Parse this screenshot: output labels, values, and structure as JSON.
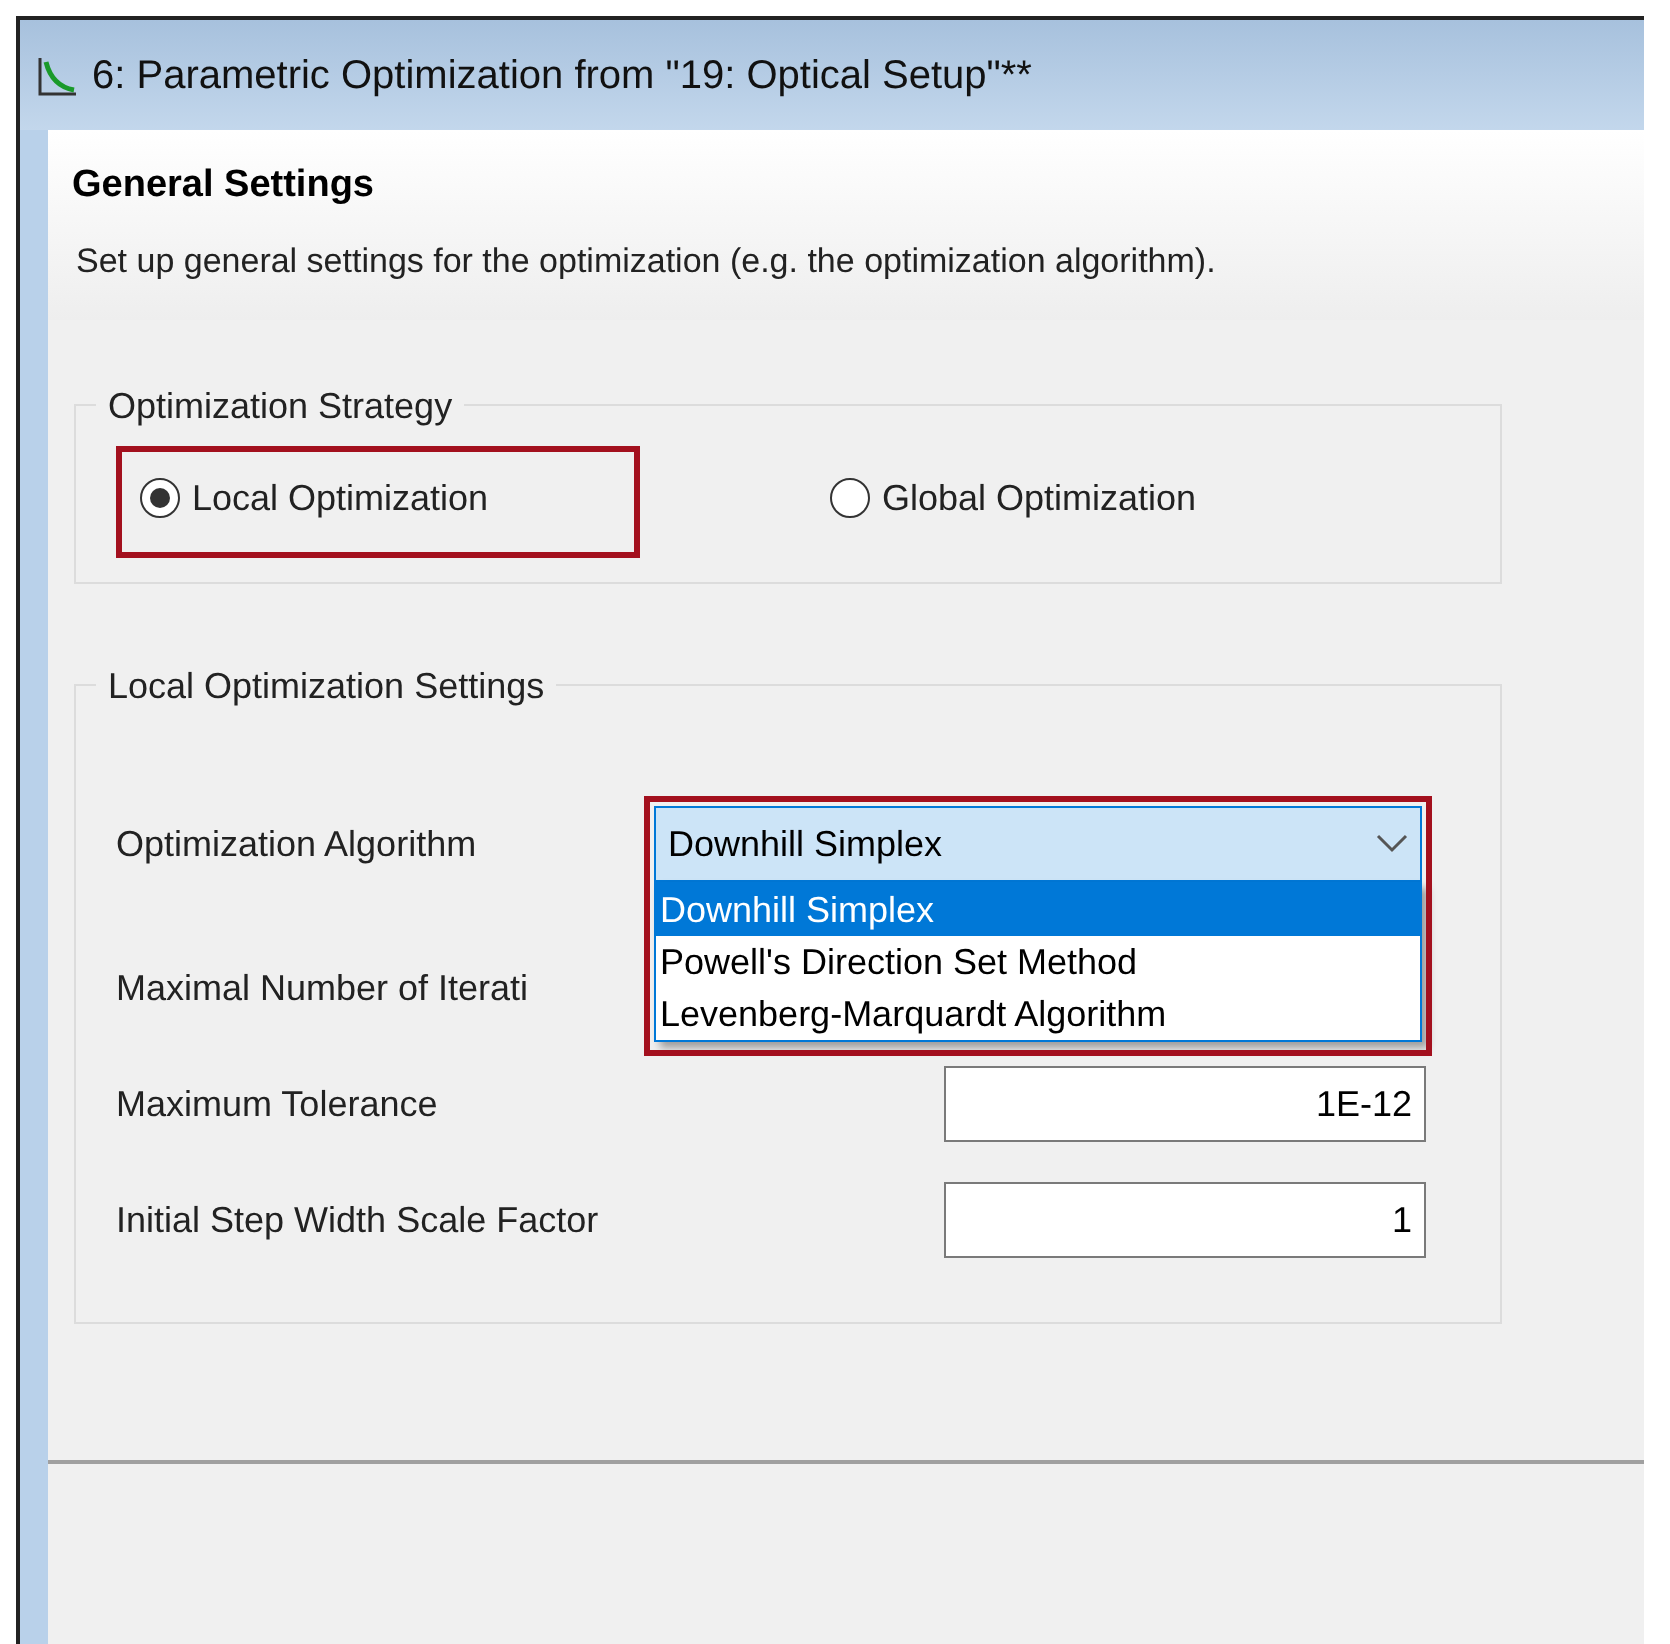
{
  "window": {
    "title": "6: Parametric Optimization from \"19: Optical Setup\"**"
  },
  "header": {
    "title": "General Settings",
    "description": "Set up general settings for the optimization (e.g. the optimization algorithm)."
  },
  "strategy": {
    "legend": "Optimization Strategy",
    "options": [
      {
        "label": "Local Optimization",
        "selected": true,
        "highlighted": true
      },
      {
        "label": "Global Optimization",
        "selected": false,
        "highlighted": false
      }
    ]
  },
  "local_settings": {
    "legend": "Local Optimization Settings",
    "algorithm": {
      "label": "Optimization Algorithm",
      "value": "Downhill Simplex",
      "expanded": true,
      "highlighted": true,
      "options": [
        {
          "label": "Downhill Simplex",
          "selected": true
        },
        {
          "label": "Powell's Direction Set Method",
          "selected": false
        },
        {
          "label": "Levenberg-Marquardt Algorithm",
          "selected": false
        }
      ]
    },
    "fields": [
      {
        "label": "Maximal Number of Iterati"
      },
      {
        "label": "Maximum Tolerance",
        "value": "1E-12"
      },
      {
        "label": "Initial Step Width Scale Factor",
        "value": "1"
      }
    ]
  }
}
